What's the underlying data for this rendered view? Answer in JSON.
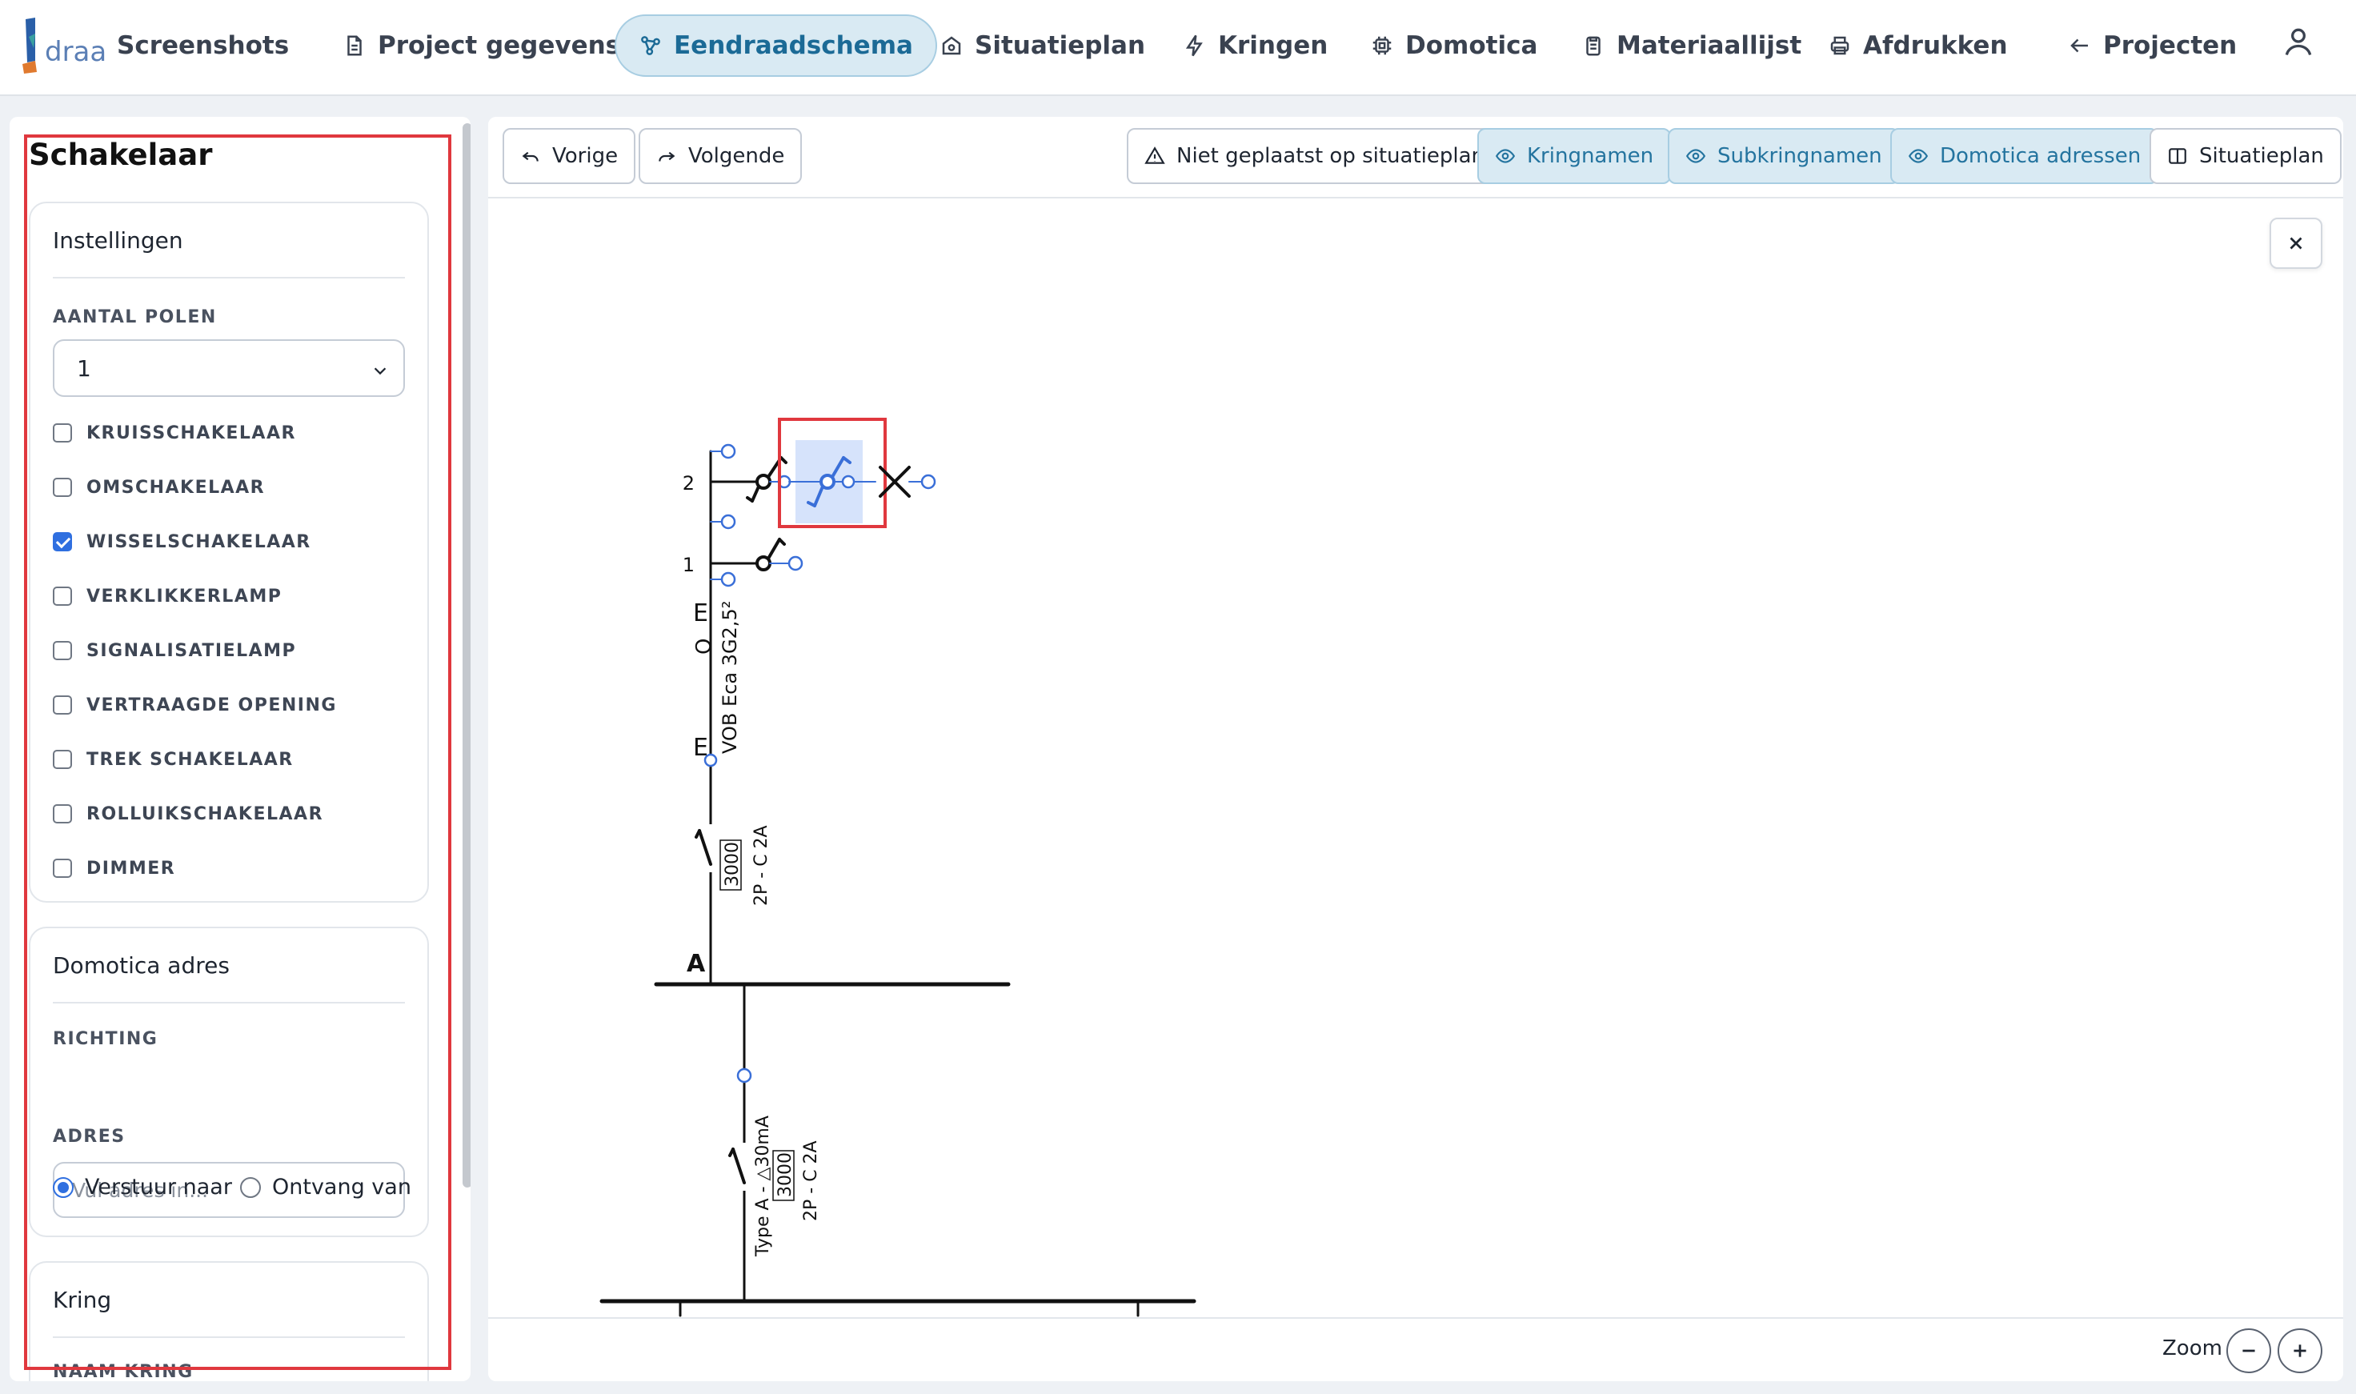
{
  "nav": {
    "brand": "Screenshots",
    "logo_text": "draad",
    "items": [
      {
        "label": "Project gegevens",
        "icon": "document-icon"
      },
      {
        "label": "Eendraadschema",
        "icon": "diagram-icon"
      },
      {
        "label": "Situatieplan",
        "icon": "house-icon"
      },
      {
        "label": "Kringen",
        "icon": "bolt-icon"
      },
      {
        "label": "Domotica",
        "icon": "chip-icon"
      },
      {
        "label": "Materiaallijst",
        "icon": "clipboard-icon"
      },
      {
        "label": "Afdrukken",
        "icon": "printer-icon"
      },
      {
        "label": "Projecten",
        "icon": "arrow-left-icon"
      }
    ],
    "active": "Eendraadschema"
  },
  "sidebar": {
    "title": "Schakelaar",
    "settings": {
      "heading": "Instellingen",
      "poles_label": "AANTAL POLEN",
      "poles_value": "1",
      "options": [
        {
          "label": "KRUISSCHAKELAAR",
          "checked": false
        },
        {
          "label": "OMSCHAKELAAR",
          "checked": false
        },
        {
          "label": "WISSELSCHAKELAAR",
          "checked": true
        },
        {
          "label": "VERKLIKKERLAMP",
          "checked": false
        },
        {
          "label": "SIGNALISATIELAMP",
          "checked": false
        },
        {
          "label": "VERTRAAGDE OPENING",
          "checked": false
        },
        {
          "label": "TREK SCHAKELAAR",
          "checked": false
        },
        {
          "label": "ROLLUIKSCHAKELAAR",
          "checked": false
        },
        {
          "label": "DIMMER",
          "checked": false
        }
      ]
    },
    "domotica": {
      "heading": "Domotica adres",
      "direction_label": "RICHTING",
      "direction_options": [
        "Verstuur naar",
        "Ontvang van"
      ],
      "direction_selected": "Verstuur naar",
      "address_label": "ADRES",
      "address_placeholder": "Vul adres in..."
    },
    "kring": {
      "heading": "Kring",
      "name_label": "NAAM KRING"
    }
  },
  "toolbar": {
    "prev": "Vorige",
    "next": "Volgende",
    "not_placed": "Niet geplaatst op situatieplan",
    "kringnamen": "Kringnamen",
    "subkringnamen": "Subkringnamen",
    "domotica_adressen": "Domotica adressen",
    "situatieplan": "Situatieplan"
  },
  "diagram": {
    "circuit_label_2": "2",
    "circuit_label_1": "1",
    "cable_label": "VOB Eca 3G2,5²",
    "cable_marks": [
      "E",
      "O",
      "E"
    ],
    "breaker_rating": "3000",
    "breaker_spec": "2P - C 2A",
    "bus_label": "A",
    "rcd_type": "Type A - △30mA",
    "rcd_rating": "3000",
    "rcd_spec": "2P - C 2A"
  },
  "zoom": {
    "label": "Zoom"
  },
  "colors": {
    "accent": "#2f6fe0",
    "nav_active_bg": "#d9eaf3",
    "nav_active_text": "#1b6a96",
    "highlight_frame": "#e0383e",
    "selection_bg": "#d6e3fb",
    "selected_symbol": "#3a6fd8"
  }
}
